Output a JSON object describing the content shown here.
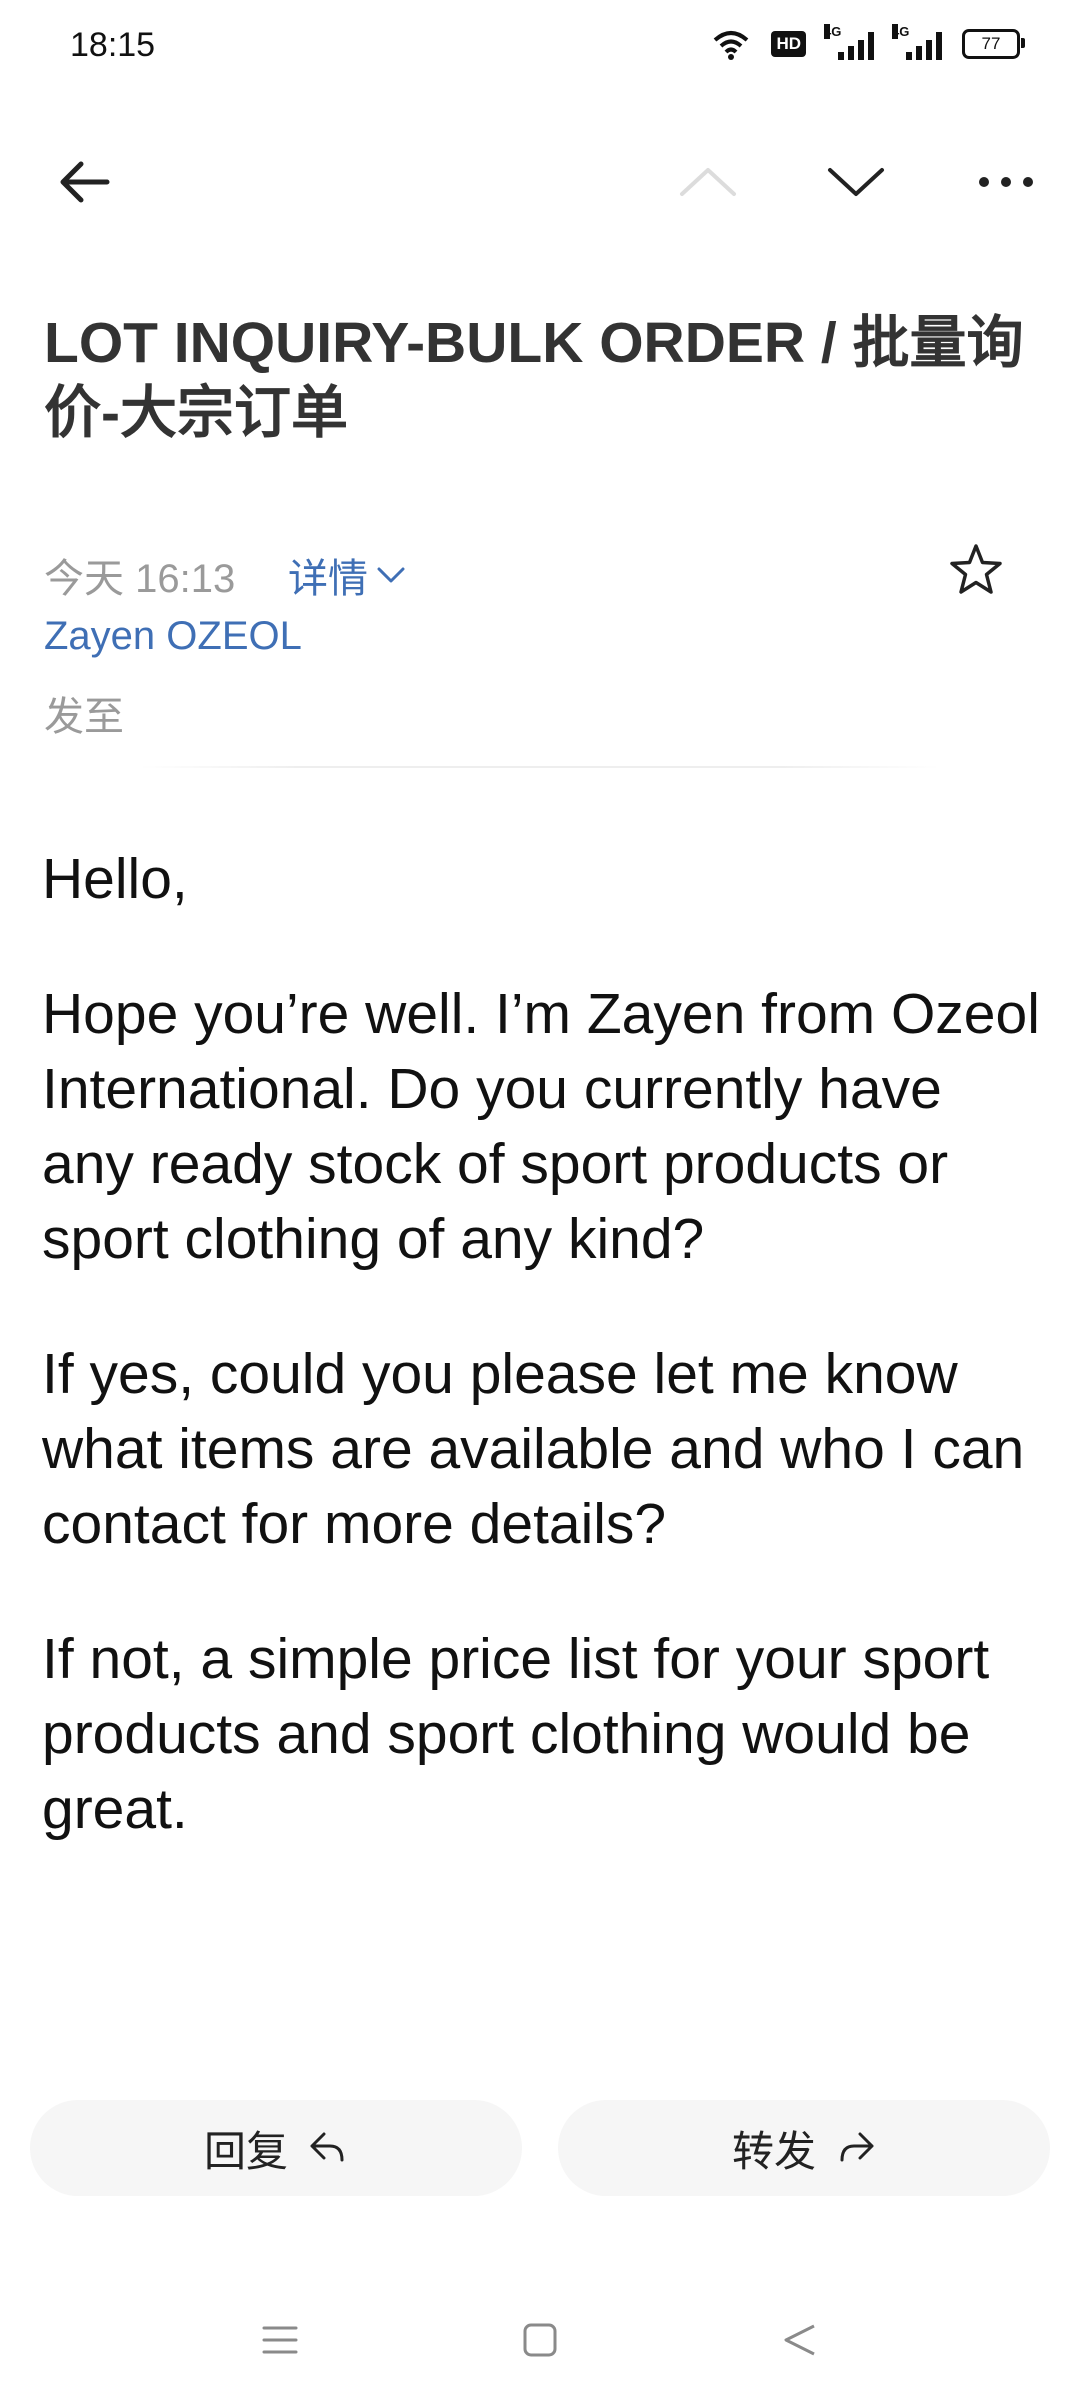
{
  "status_bar": {
    "time": "18:15",
    "network_1": "4G",
    "network_2": "4G",
    "hd": "HD",
    "battery": "77"
  },
  "toolbar": {
    "back_icon": "arrow-left-icon",
    "prev_icon": "chevron-up-icon",
    "next_icon": "chevron-down-icon",
    "more_icon": "more-horizontal-icon"
  },
  "email": {
    "subject": "LOT INQUIRY-BULK ORDER / 批量询价-大宗订单",
    "date": "今天 16:13",
    "details_label": "详情",
    "sender": "Zayen OZEOL",
    "sent_to_label": "发至",
    "body": [
      "Hello,",
      "Hope you’re well. I’m Zayen from Ozeol International. Do you currently have any ready stock of sport products or sport clothing of any kind?",
      "If yes, could you please let me know what items are available and who I can contact for more details?",
      "If not, a simple price list for your sport products and sport clothing would be great."
    ]
  },
  "actions": {
    "reply_label": "回复",
    "forward_label": "转发"
  },
  "colors": {
    "link": "#3f6fb5",
    "muted": "#9a9a9a",
    "button_bg": "#f6f6f6"
  }
}
